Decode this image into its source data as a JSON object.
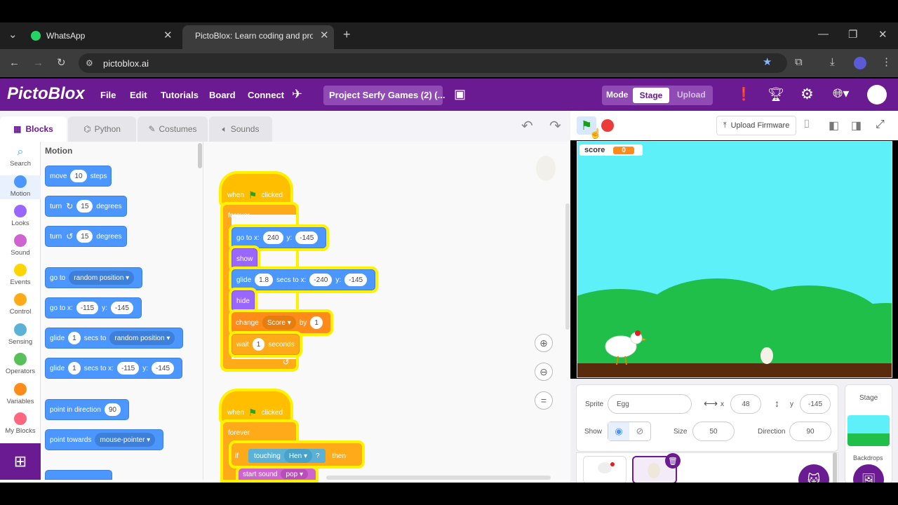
{
  "browser": {
    "tabs": [
      {
        "title": "WhatsApp"
      },
      {
        "title": "PictoBlox: Learn coding and pro"
      }
    ],
    "url": "pictoblox.ai"
  },
  "app": {
    "logo": "PictoBlox",
    "menu": [
      "File",
      "Edit",
      "Tutorials",
      "Board",
      "Connect"
    ],
    "project_title": "Project Serfy Games (2) (...",
    "mode_label": "Mode",
    "mode_stage": "Stage",
    "mode_upload": "Upload",
    "accent": "#6b1b91"
  },
  "panel_tabs": [
    "Blocks",
    "Python",
    "Costumes",
    "Sounds"
  ],
  "categories": [
    {
      "label": "Search",
      "color": "#4c97ff"
    },
    {
      "label": "Motion",
      "color": "#4c97ff"
    },
    {
      "label": "Looks",
      "color": "#9966ff"
    },
    {
      "label": "Sound",
      "color": "#cf63cf"
    },
    {
      "label": "Events",
      "color": "#ffd500"
    },
    {
      "label": "Control",
      "color": "#ffab19"
    },
    {
      "label": "Sensing",
      "color": "#5cb1d6"
    },
    {
      "label": "Operators",
      "color": "#59c059"
    },
    {
      "label": "Variables",
      "color": "#ff8c1a"
    },
    {
      "label": "My Blocks",
      "color": "#ff6680"
    }
  ],
  "palette": {
    "heading": "Motion",
    "move": {
      "a": "move",
      "n": "10",
      "b": "steps"
    },
    "turn_right": {
      "a": "turn",
      "n": "15",
      "b": "degrees"
    },
    "turn_left": {
      "a": "turn",
      "n": "15",
      "b": "degrees"
    },
    "goto": {
      "a": "go to",
      "dd": "random position"
    },
    "goto_xy": {
      "a": "go to x:",
      "x": "-115",
      "b": "y:",
      "y": "-145"
    },
    "glide_rand": {
      "a": "glide",
      "n": "1",
      "b": "secs to",
      "dd": "random position"
    },
    "glide_xy": {
      "a": "glide",
      "n": "1",
      "b": "secs to x:",
      "x": "-115",
      "c": "y:",
      "y": "-145"
    },
    "point_dir": {
      "a": "point in direction",
      "n": "90"
    },
    "point_towards": {
      "a": "point towards",
      "dd": "mouse-pointer"
    }
  },
  "script1": {
    "hat": {
      "a": "when",
      "b": "clicked"
    },
    "forever": "forever",
    "goto": {
      "a": "go to x:",
      "x": "240",
      "b": "y:",
      "y": "-145"
    },
    "show": "show",
    "glide": {
      "a": "glide",
      "n": "1.8",
      "b": "secs to x:",
      "x": "-240",
      "c": "y:",
      "y": "-145"
    },
    "hide": "hide",
    "change": {
      "a": "change",
      "dd": "Score",
      "b": "by",
      "n": "1"
    },
    "wait": {
      "a": "wait",
      "n": "1",
      "b": "seconds"
    }
  },
  "script2": {
    "hat": {
      "a": "when",
      "b": "clicked"
    },
    "forever": "forever",
    "if": {
      "a": "if",
      "b": "touching",
      "dd": "Hen",
      "q": "?",
      "c": "then"
    },
    "sound": {
      "a": "start sound",
      "dd": "pop"
    }
  },
  "stage_toolbar": {
    "upload_firmware": "Upload Firmware"
  },
  "stage": {
    "monitor_label": "score",
    "monitor_value": "0"
  },
  "sprite_info": {
    "sprite_label": "Sprite",
    "sprite_name": "Egg",
    "x_label": "x",
    "x": "48",
    "y_label": "y",
    "y": "-145",
    "show_label": "Show",
    "size_label": "Size",
    "size": "50",
    "direction_label": "Direction",
    "direction": "90"
  },
  "stage_pane": {
    "title": "Stage",
    "backdrops": "Backdrops"
  }
}
